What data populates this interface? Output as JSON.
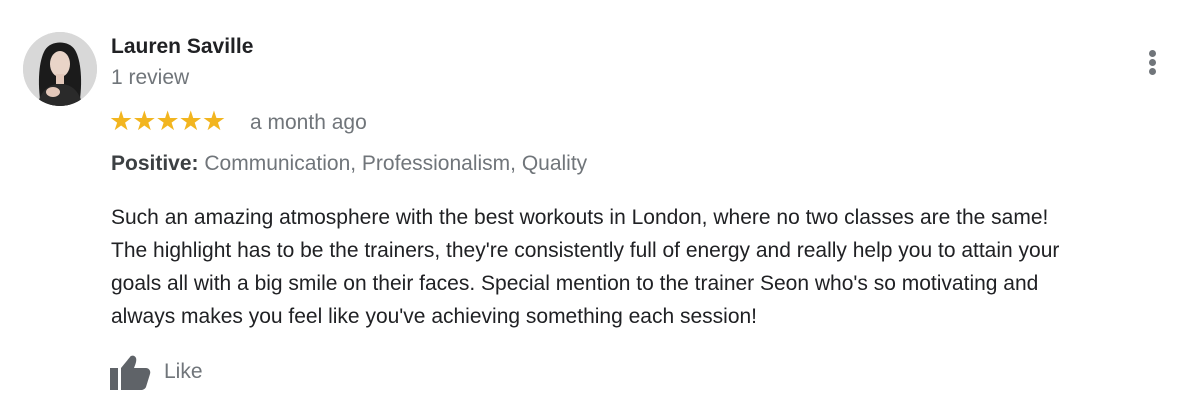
{
  "review": {
    "reviewer_name": "Lauren Saville",
    "review_count": "1 review",
    "rating": 5,
    "rating_max": 5,
    "stars": [
      "★",
      "★",
      "★",
      "★",
      "★"
    ],
    "date": "a month ago",
    "attributes_label": "Positive:",
    "attributes_values": " Communication, Professionalism, Quality",
    "text_lines": [
      "Such an amazing atmosphere with the best workouts in London, where no two classes are the same!",
      "The highlight has to be the trainers, they're consistently full of energy and really help you to attain your",
      "goals all with a big smile on their faces. Special mention to the trainer Seon who's so motivating and",
      "always makes you feel like you've achieving something each session!"
    ],
    "like_label": "Like"
  },
  "icons": {
    "more": "more-vert-icon",
    "like": "thumbs-up-icon",
    "star": "star-icon"
  },
  "colors": {
    "star": "#f2b51f",
    "secondary_text": "#70757a",
    "primary_text": "#202124"
  }
}
